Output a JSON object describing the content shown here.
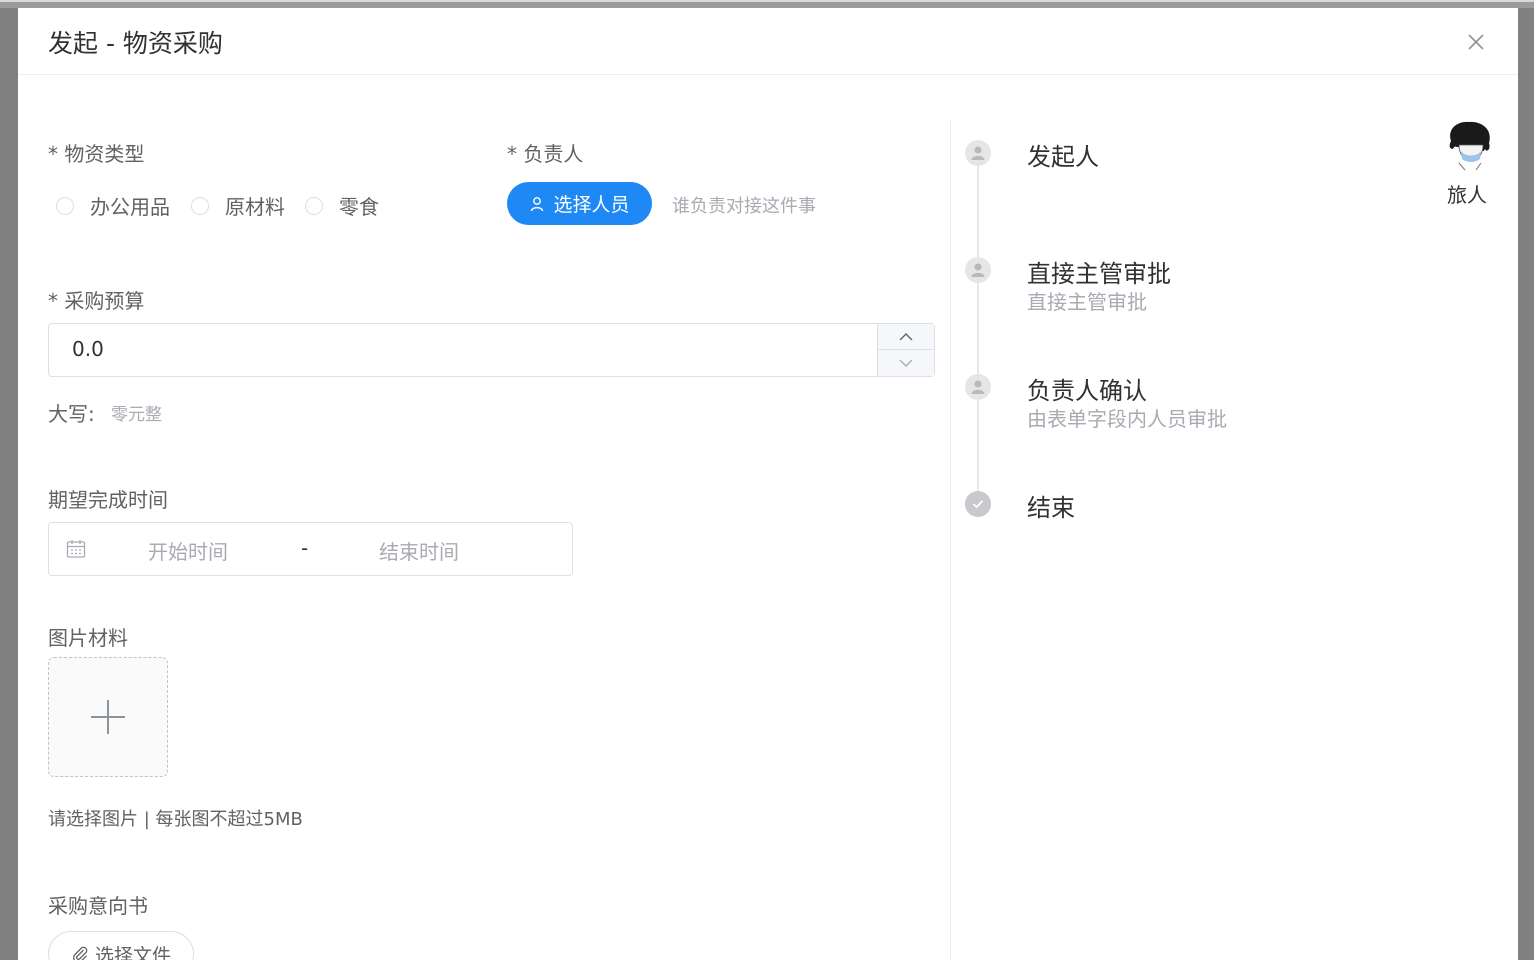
{
  "dialog": {
    "title": "发起 - 物资采购"
  },
  "form": {
    "material_type": {
      "label": "* 物资类型",
      "options": [
        "办公用品",
        "原材料",
        "零食"
      ]
    },
    "owner": {
      "label": "* 负责人",
      "button_label": "选择人员",
      "hint": "谁负责对接这件事"
    },
    "budget": {
      "label": "* 采购预算",
      "value": "0.0",
      "uppercase_label": "大写:",
      "uppercase_value": "零元整"
    },
    "expected_time": {
      "label": "期望完成时间",
      "start_placeholder": "开始时间",
      "separator": "-",
      "end_placeholder": "结束时间"
    },
    "images": {
      "label": "图片材料",
      "hint": "请选择图片 | 每张图不超过5MB"
    },
    "intent_letter": {
      "label": "采购意向书",
      "button_label": "选择文件"
    }
  },
  "process": {
    "nodes": [
      {
        "title": "发起人",
        "subtitle": "",
        "icon": "user-icon"
      },
      {
        "title": "直接主管审批",
        "subtitle": "直接主管审批",
        "icon": "user-icon"
      },
      {
        "title": "负责人确认",
        "subtitle": "由表单字段内人员审批",
        "icon": "user-icon"
      },
      {
        "title": "结束",
        "subtitle": "",
        "icon": "check-circle-icon"
      }
    ],
    "initiator": {
      "name": "旅人"
    }
  },
  "colors": {
    "primary": "#1e88f5",
    "overlay": "#808080",
    "border": "#dcdfe6",
    "placeholder": "#a8abb2"
  }
}
